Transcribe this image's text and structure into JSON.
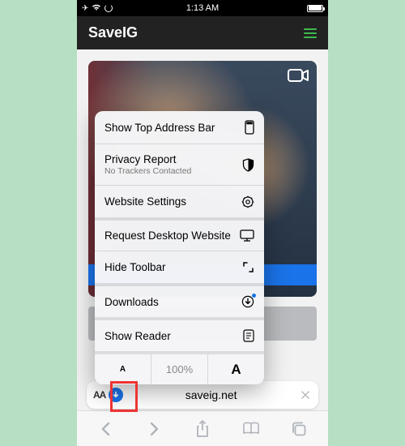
{
  "status": {
    "time": "1:13 AM"
  },
  "site": {
    "title": "SaveIG"
  },
  "menu": {
    "show_top_address": "Show Top Address Bar",
    "privacy_report": "Privacy Report",
    "privacy_sub": "No Trackers Contacted",
    "website_settings": "Website Settings",
    "request_desktop": "Request Desktop Website",
    "hide_toolbar": "Hide Toolbar",
    "downloads": "Downloads",
    "show_reader": "Show Reader",
    "zoom_level": "100%",
    "zoom_small": "A",
    "zoom_big": "A"
  },
  "address": {
    "aa": "AA",
    "domain": "saveig.net"
  }
}
